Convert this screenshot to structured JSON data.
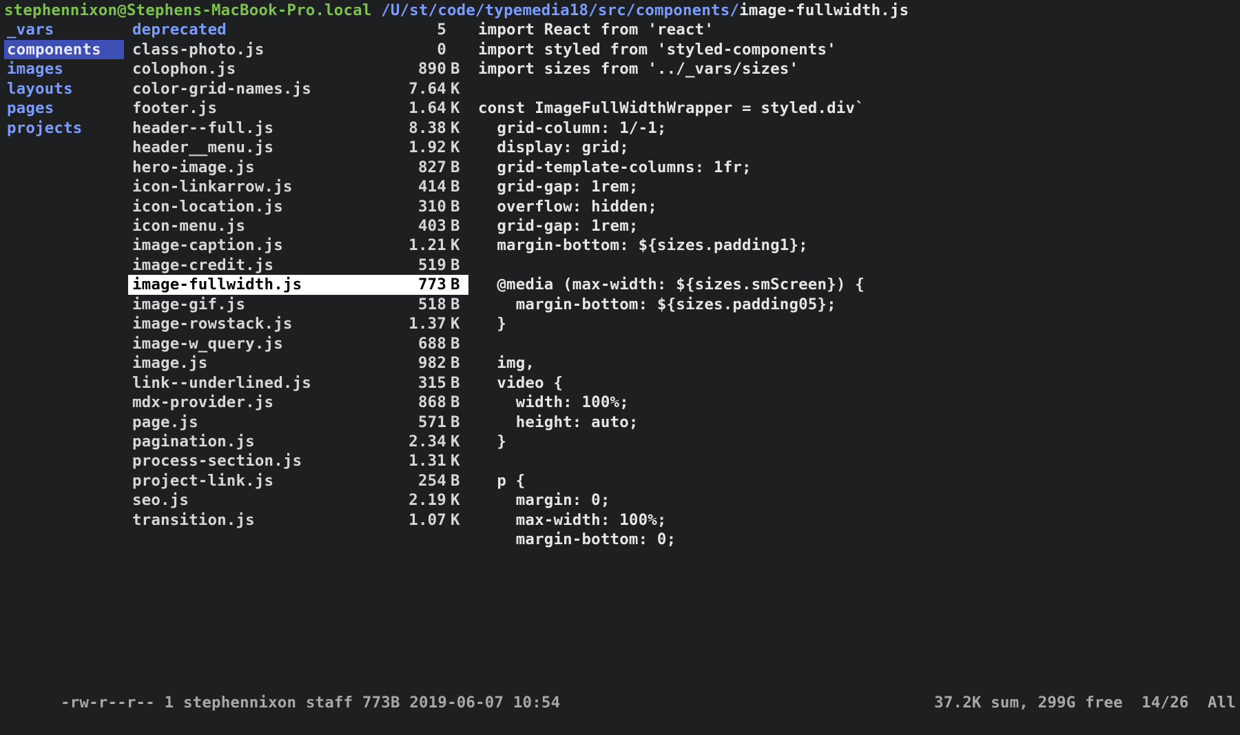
{
  "titlebar": {
    "user_host": "stephennixon@Stephens-MacBook-Pro.local",
    "path_prefix": "/U/st/code/typemedia18/src/components/",
    "filename": "image-fullwidth.js"
  },
  "dirs": {
    "items": [
      {
        "name": "_vars",
        "selected": false
      },
      {
        "name": "components",
        "selected": true
      },
      {
        "name": "images",
        "selected": false
      },
      {
        "name": "layouts",
        "selected": false
      },
      {
        "name": "pages",
        "selected": false
      },
      {
        "name": "projects",
        "selected": false
      }
    ]
  },
  "files": {
    "items": [
      {
        "name": "deprecated",
        "size": "5",
        "unit": "",
        "dir": true,
        "selected": false
      },
      {
        "name": "class-photo.js",
        "size": "0",
        "unit": "",
        "dir": false,
        "selected": false
      },
      {
        "name": "colophon.js",
        "size": "890",
        "unit": "B",
        "dir": false,
        "selected": false
      },
      {
        "name": "color-grid-names.js",
        "size": "7.64",
        "unit": "K",
        "dir": false,
        "selected": false
      },
      {
        "name": "footer.js",
        "size": "1.64",
        "unit": "K",
        "dir": false,
        "selected": false
      },
      {
        "name": "header--full.js",
        "size": "8.38",
        "unit": "K",
        "dir": false,
        "selected": false
      },
      {
        "name": "header__menu.js",
        "size": "1.92",
        "unit": "K",
        "dir": false,
        "selected": false
      },
      {
        "name": "hero-image.js",
        "size": "827",
        "unit": "B",
        "dir": false,
        "selected": false
      },
      {
        "name": "icon-linkarrow.js",
        "size": "414",
        "unit": "B",
        "dir": false,
        "selected": false
      },
      {
        "name": "icon-location.js",
        "size": "310",
        "unit": "B",
        "dir": false,
        "selected": false
      },
      {
        "name": "icon-menu.js",
        "size": "403",
        "unit": "B",
        "dir": false,
        "selected": false
      },
      {
        "name": "image-caption.js",
        "size": "1.21",
        "unit": "K",
        "dir": false,
        "selected": false
      },
      {
        "name": "image-credit.js",
        "size": "519",
        "unit": "B",
        "dir": false,
        "selected": false
      },
      {
        "name": "image-fullwidth.js",
        "size": "773",
        "unit": "B",
        "dir": false,
        "selected": true
      },
      {
        "name": "image-gif.js",
        "size": "518",
        "unit": "B",
        "dir": false,
        "selected": false
      },
      {
        "name": "image-rowstack.js",
        "size": "1.37",
        "unit": "K",
        "dir": false,
        "selected": false
      },
      {
        "name": "image-w_query.js",
        "size": "688",
        "unit": "B",
        "dir": false,
        "selected": false
      },
      {
        "name": "image.js",
        "size": "982",
        "unit": "B",
        "dir": false,
        "selected": false
      },
      {
        "name": "link--underlined.js",
        "size": "315",
        "unit": "B",
        "dir": false,
        "selected": false
      },
      {
        "name": "mdx-provider.js",
        "size": "868",
        "unit": "B",
        "dir": false,
        "selected": false
      },
      {
        "name": "page.js",
        "size": "571",
        "unit": "B",
        "dir": false,
        "selected": false
      },
      {
        "name": "pagination.js",
        "size": "2.34",
        "unit": "K",
        "dir": false,
        "selected": false
      },
      {
        "name": "process-section.js",
        "size": "1.31",
        "unit": "K",
        "dir": false,
        "selected": false
      },
      {
        "name": "project-link.js",
        "size": "254",
        "unit": "B",
        "dir": false,
        "selected": false
      },
      {
        "name": "seo.js",
        "size": "2.19",
        "unit": "K",
        "dir": false,
        "selected": false
      },
      {
        "name": "transition.js",
        "size": "1.07",
        "unit": "K",
        "dir": false,
        "selected": false
      }
    ]
  },
  "preview": {
    "lines": [
      "import React from 'react'",
      "import styled from 'styled-components'",
      "import sizes from '../_vars/sizes'",
      "",
      "const ImageFullWidthWrapper = styled.div`",
      "  grid-column: 1/-1;",
      "  display: grid;",
      "  grid-template-columns: 1fr;",
      "  grid-gap: 1rem;",
      "  overflow: hidden;",
      "  grid-gap: 1rem;",
      "  margin-bottom: ${sizes.padding1};",
      "",
      "  @media (max-width: ${sizes.smScreen}) {",
      "    margin-bottom: ${sizes.padding05};",
      "  }",
      "",
      "  img,",
      "  video {",
      "    width: 100%;",
      "    height: auto;",
      "  }",
      "",
      "  p {",
      "    margin: 0;",
      "    max-width: 100%;",
      "    margin-bottom: 0;"
    ]
  },
  "status": {
    "perms": "-rw-r--r--",
    "links": "1",
    "owner": "stephennixon",
    "group": "staff",
    "size": "773B",
    "date": "2019-06-07",
    "time": "10:54",
    "sum": "37.2K sum,",
    "free": "299G free",
    "pos": "14/26",
    "scroll": "All"
  }
}
